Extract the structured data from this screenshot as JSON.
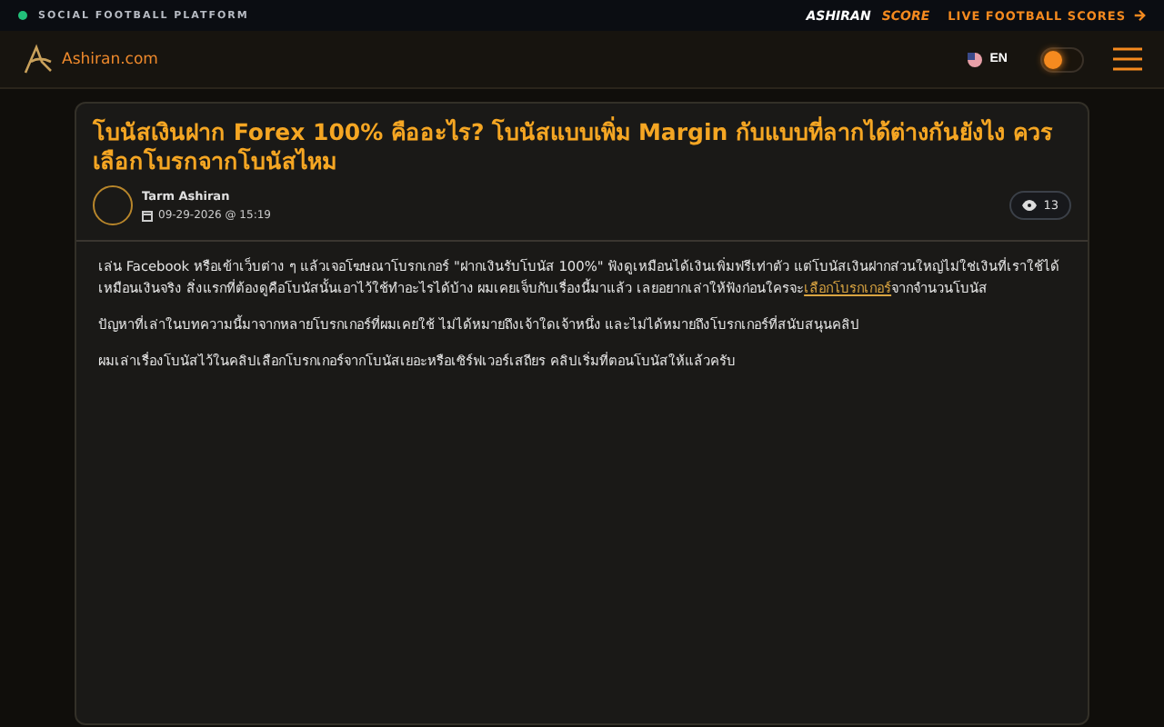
{
  "top_bar": {
    "tagline": "SOCIAL FOOTBALL PLATFORM",
    "score_brand": [
      "ASHIRAN",
      "SCORE"
    ],
    "live_link": "LIVE FOOTBALL SCORES"
  },
  "header": {
    "logo_text": "Ashiran.com",
    "language": "EN",
    "dark_mode": {
      "on": true
    }
  },
  "article": {
    "title": "โบนัสเงินฝาก Forex 100% คืออะไร? โบนัสแบบเพิ่ม Margin กับแบบที่ลากได้ต่างกันยังไง ควรเลือกโบรกจากโบนัสไหม",
    "author": "Tarm Ashiran",
    "date": "09-29-2026 @ 15:19",
    "views": "13",
    "paragraphs": [
      {
        "parts": [
          {
            "kind": "text",
            "text": "เล่น Facebook หรือเข้าเว็บต่าง ๆ แล้วเจอโฆษณาโบรกเกอร์ \"ฝากเงินรับโบนัส 100%\" ฟังดูเหมือนได้เงินเพิ่มฟรีเท่าตัว แต่โบนัสเงินฝากส่วนใหญ่ไม่ใช่เงินที่เราใช้ได้เหมือนเงินจริง สิ่งแรกที่ต้องดูคือโบนัสนั้นเอาไว้ใช้ทำอะไรได้บ้าง ผมเคยเจ็บกับเรื่องนี้มาแล้ว เลยอยากเล่าให้ฟังก่อนใครจะ"
          },
          {
            "kind": "link",
            "text": "เลือกโบรกเกอร์"
          },
          {
            "kind": "text",
            "text": "จากจำนวนโบนัส"
          }
        ]
      },
      {
        "parts": [
          {
            "kind": "text",
            "text": "ปัญหาที่เล่าในบทความนี้มาจากหลายโบรกเกอร์ที่ผมเคยใช้ ไม่ได้หมายถึงเจ้าใดเจ้าหนึ่ง และไม่ได้หมายถึงโบรกเกอร์ที่สนับสนุนคลิป"
          }
        ]
      },
      {
        "parts": [
          {
            "kind": "text",
            "text": "ผมเล่าเรื่องโบนัสไว้ในคลิปเลือกโบรกเกอร์จากโบนัสเยอะหรือเซิร์ฟเวอร์เสถียร คลิปเริ่มที่ตอนโบนัสให้แล้วครับ"
          }
        ]
      }
    ]
  }
}
